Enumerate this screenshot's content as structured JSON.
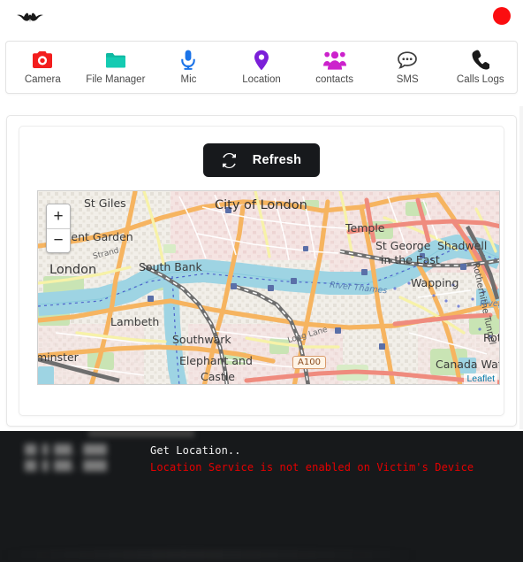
{
  "header": {
    "logo_icon": "bat-logo-icon",
    "status_indicator": {
      "name": "recording-status-dot",
      "color": "#fb0d10"
    }
  },
  "nav": {
    "items": [
      {
        "label": "Camera",
        "icon": "camera-icon",
        "color": "#f31d1d"
      },
      {
        "label": "File Manager",
        "icon": "folder-icon",
        "color": "#0fb8a1"
      },
      {
        "label": "Mic",
        "icon": "mic-icon",
        "color": "#1a73e8"
      },
      {
        "label": "Location",
        "icon": "map-pin-icon",
        "color": "#7b1fd8"
      },
      {
        "label": "contacts",
        "icon": "contacts-icon",
        "color": "#cc22cc"
      },
      {
        "label": "SMS",
        "icon": "chat-bubble-icon",
        "color": "#3d3d3d"
      },
      {
        "label": "Calls Logs",
        "icon": "phone-icon",
        "color": "#1a1a1a"
      }
    ]
  },
  "panel": {
    "refresh_button": {
      "label": "Refresh",
      "icon": "refresh-sync-icon",
      "bg_color": "#17191c",
      "text_color": "#ffffff"
    },
    "map": {
      "provider": "Leaflet",
      "attribution_label": "Leaflet",
      "attribution_color": "#0078a8",
      "zoom_in_label": "+",
      "zoom_out_label": "−",
      "place_labels": [
        "St Giles",
        "City of London",
        "Temple",
        "vent Garden",
        "Strand",
        "London",
        "South Bank",
        "River Thames",
        "St George",
        "in the East",
        "Shadwell",
        "Wapping",
        "Rotherhithe Tunnel",
        "Lambeth",
        "Southwark",
        "minster",
        "Elephant and",
        "Castle",
        "Long Lane",
        "River",
        "Canada Wat",
        "Roth",
        "A100"
      ]
    }
  },
  "terminal": {
    "timestamps": [
      "██ █ ███, ████",
      "██ █ ███, ████"
    ],
    "messages": [
      {
        "text": "Get Location..",
        "level": "info",
        "color": "#f2f2f2"
      },
      {
        "text": "Location Service is not enabled on Victim's Device",
        "level": "error",
        "color": "#e60000"
      }
    ]
  }
}
